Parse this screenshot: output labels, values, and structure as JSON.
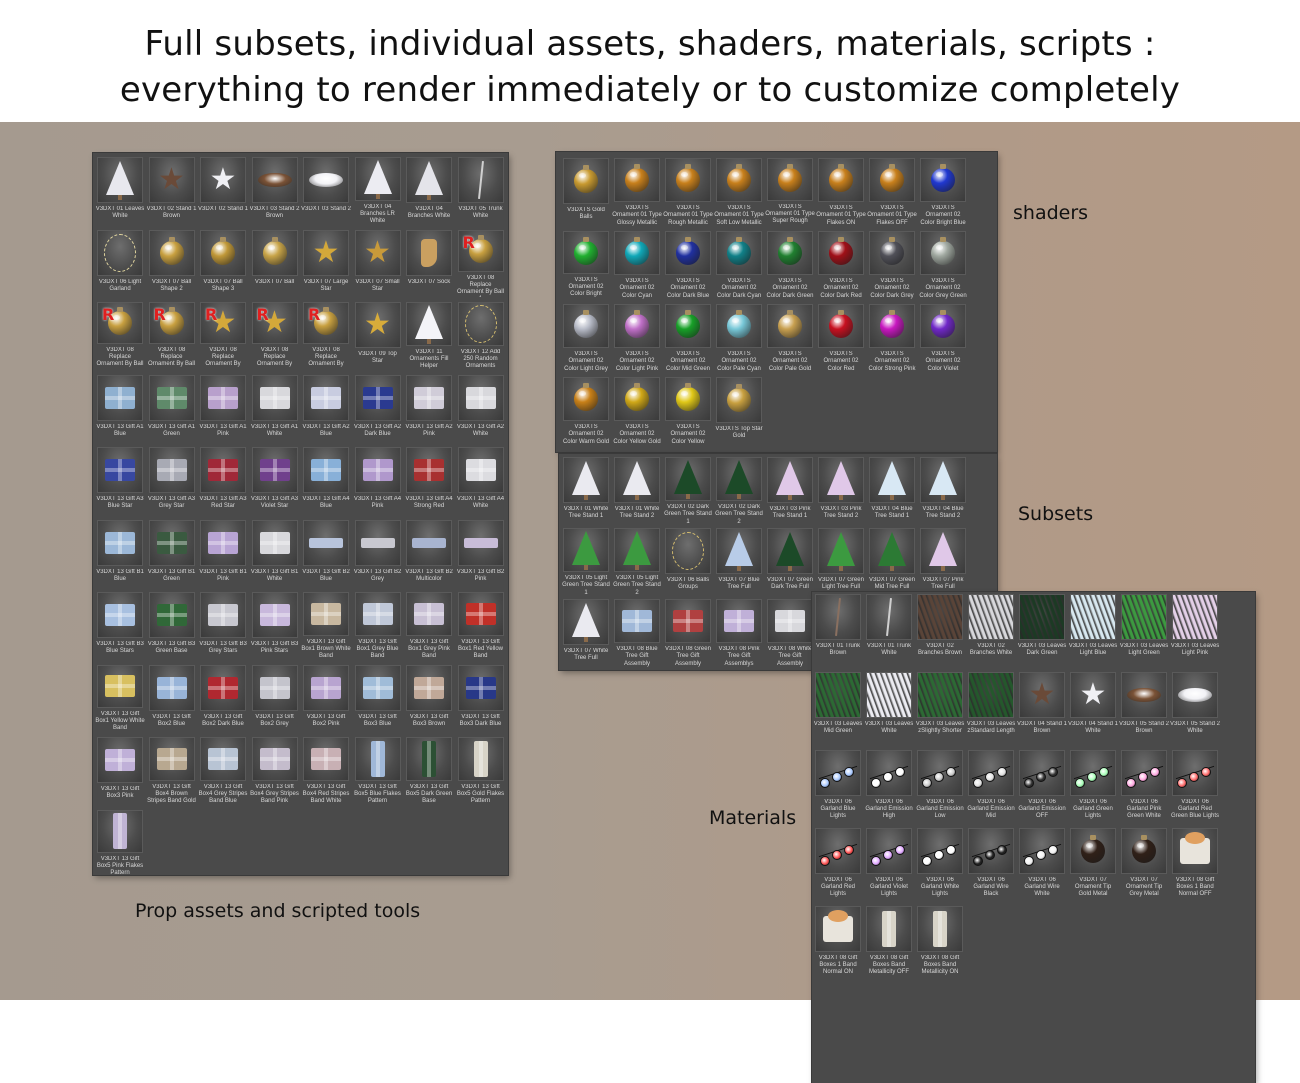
{
  "headline": {
    "line1": "Full subsets, individual assets, shaders, materials, scripts :",
    "line2": "everything to render immediately or to customize completely"
  },
  "labels": {
    "props": "Prop assets and scripted tools",
    "shaders": "shaders",
    "subsets": "Subsets",
    "materials": "Materials"
  },
  "props_panel": [
    {
      "name": "V3DXT 01 Leaves White",
      "icon": "tree-icon",
      "color": "#e8e8ee"
    },
    {
      "name": "V3DXT 02 Stand 1 Brown",
      "icon": "star-icon",
      "color": "#6a4a38"
    },
    {
      "name": "V3DXT 02 Stand 1",
      "icon": "star-icon",
      "color": "#f0f0f4"
    },
    {
      "name": "V3DXT 03 Stand 2 Brown",
      "icon": "disc-icon",
      "color": "#7a5236"
    },
    {
      "name": "V3DXT 03 Stand 2",
      "icon": "disc-icon",
      "color": "#f2f2f6"
    },
    {
      "name": "V3DXT 04 Branches LR White",
      "icon": "tree-icon",
      "color": "#ececf2"
    },
    {
      "name": "V3DXT 04 Branches White",
      "icon": "tree-icon",
      "color": "#e4e4ea"
    },
    {
      "name": "V3DXT 05 Trunk White",
      "icon": "needle-icon",
      "color": "#d0d0d0"
    },
    {
      "name": "V3DXT 06 Light Garland",
      "icon": "string-icon",
      "color": "#e4d8a0"
    },
    {
      "name": "V3DXT 07 Ball Shape 2",
      "icon": "ball-icon",
      "color": "#c8a040"
    },
    {
      "name": "V3DXT 07 Ball Shape 3",
      "icon": "ball-icon",
      "color": "#c09838"
    },
    {
      "name": "V3DXT 07 Ball",
      "icon": "ball-icon",
      "color": "#c8a448"
    },
    {
      "name": "V3DXT 07 Large Star",
      "icon": "star-icon",
      "color": "#d4a83a"
    },
    {
      "name": "V3DXT 07 Small Star",
      "icon": "star-icon",
      "color": "#c89a3a"
    },
    {
      "name": "V3DXT 07 Sock",
      "icon": "sock-icon",
      "color": "#caa060"
    },
    {
      "name": "V3DXT 08 Replace Ornament By Ball 1",
      "icon": "replace-ball-icon",
      "color": "#c8a040"
    },
    {
      "name": "V3DXT 08 Replace Ornament By Ball 2",
      "icon": "replace-ball-icon",
      "color": "#c8a040"
    },
    {
      "name": "V3DXT 08 Replace Ornament By Ball 3",
      "icon": "replace-ball-icon",
      "color": "#c8a040"
    },
    {
      "name": "V3DXT 08 Replace Ornament By Large Star",
      "icon": "replace-star-icon",
      "color": "#d4a83a"
    },
    {
      "name": "V3DXT 08 Replace Ornament By Small Star",
      "icon": "replace-star-icon",
      "color": "#d4a83a"
    },
    {
      "name": "V3DXT 08 Replace Ornament By Sock",
      "icon": "replace-ball-icon",
      "color": "#c8a040"
    },
    {
      "name": "V3DXT 09 Top Star",
      "icon": "star-icon",
      "color": "#d8ac3a"
    },
    {
      "name": "V3DXT 11 Ornaments Fill Helper",
      "icon": "tree-icon",
      "color": "#f4f4f8"
    },
    {
      "name": "V3DXT 12 Add 250 Random Ornaments",
      "icon": "string-icon",
      "color": "#d8c070"
    },
    {
      "name": "V3DXT 13 Gift A1 Blue",
      "icon": "box-icon",
      "color": "#8fb0d0"
    },
    {
      "name": "V3DXT 13 Gift A1 Green",
      "icon": "box-icon",
      "color": "#5f8a6a"
    },
    {
      "name": "V3DXT 13 Gift A1 Pink",
      "icon": "box-icon",
      "color": "#b8a0cc"
    },
    {
      "name": "V3DXT 13 Gift A1 White",
      "icon": "box-icon",
      "color": "#d8d8dc"
    },
    {
      "name": "V3DXT 13 Gift A2 Blue",
      "icon": "box-icon",
      "color": "#c8cce0"
    },
    {
      "name": "V3DXT 13 Gift A2 Dark Blue",
      "icon": "box-icon",
      "color": "#2a3a90"
    },
    {
      "name": "V3DXT 13 Gift A2 Pink",
      "icon": "box-icon",
      "color": "#d0ccd8"
    },
    {
      "name": "V3DXT 13 Gift A2 White",
      "icon": "box-icon",
      "color": "#d8d8dc"
    },
    {
      "name": "V3DXT 13 Gift A3 Blue Star",
      "icon": "box-icon",
      "color": "#3848a0"
    },
    {
      "name": "V3DXT 13 Gift A3 Grey Star",
      "icon": "box-icon",
      "color": "#a8aab4"
    },
    {
      "name": "V3DXT 13 Gift A3 Red Star",
      "icon": "box-icon",
      "color": "#a02838"
    },
    {
      "name": "V3DXT 13 Gift A3 Violet Star",
      "icon": "box-icon",
      "color": "#70408c"
    },
    {
      "name": "V3DXT 13 Gift A4 Blue",
      "icon": "box-icon",
      "color": "#88b0d8"
    },
    {
      "name": "V3DXT 13 Gift A4 Pink",
      "icon": "box-icon",
      "color": "#b098cc"
    },
    {
      "name": "V3DXT 13 Gift A4 Strong Red",
      "icon": "box-icon",
      "color": "#a83030"
    },
    {
      "name": "V3DXT 13 Gift A4 White",
      "icon": "box-icon",
      "color": "#dcdce0"
    },
    {
      "name": "V3DXT 13 Gift B1 Blue",
      "icon": "box-icon",
      "color": "#9cb8d8"
    },
    {
      "name": "V3DXT 13 Gift B1 Green",
      "icon": "box-icon",
      "color": "#3a5a40"
    },
    {
      "name": "V3DXT 13 Gift B1 Pink",
      "icon": "box-icon",
      "color": "#b8a4d4"
    },
    {
      "name": "V3DXT 13 Gift B1 White",
      "icon": "box-icon",
      "color": "#d8d8dc"
    },
    {
      "name": "V3DXT 13 Gift B2 Blue",
      "icon": "slab-icon",
      "color": "#b8c4dc"
    },
    {
      "name": "V3DXT 13 Gift B2 Grey",
      "icon": "slab-icon",
      "color": "#c8c8d0"
    },
    {
      "name": "V3DXT 13 Gift B2 Multicolor",
      "icon": "slab-icon",
      "color": "#a8b4d0"
    },
    {
      "name": "V3DXT 13 Gift B2 Pink",
      "icon": "slab-icon",
      "color": "#c8bcd8"
    },
    {
      "name": "V3DXT 13 Gift B3 Blue Stars",
      "icon": "box-icon",
      "color": "#a8c0e0"
    },
    {
      "name": "V3DXT 13 Gift B3 Green Base",
      "icon": "box-icon",
      "color": "#306838"
    },
    {
      "name": "V3DXT 13 Gift B3 Grey Stars",
      "icon": "box-icon",
      "color": "#c8c8d0"
    },
    {
      "name": "V3DXT 13 Gift B3 Pink Stars",
      "icon": "box-icon",
      "color": "#c8b8dc"
    },
    {
      "name": "V3DXT 13 Gift Box1 Brown White Band",
      "icon": "box-icon",
      "color": "#c8b8a0"
    },
    {
      "name": "V3DXT 13 Gift Box1 Grey Blue Band",
      "icon": "box-icon",
      "color": "#c0c8d8"
    },
    {
      "name": "V3DXT 13 Gift Box1 Grey Pink Band",
      "icon": "box-icon",
      "color": "#c8c0d4"
    },
    {
      "name": "V3DXT 13 Gift Box1 Red Yellow Band",
      "icon": "box-icon",
      "color": "#c03028"
    },
    {
      "name": "V3DXT 13 Gift Box1 Yellow White Band",
      "icon": "box-icon",
      "color": "#d8c060"
    },
    {
      "name": "V3DXT 13 Gift Box2 Blue",
      "icon": "box-icon",
      "color": "#98b4d8"
    },
    {
      "name": "V3DXT 13 Gift Box2 Dark Blue",
      "icon": "box-icon",
      "color": "#b02830"
    },
    {
      "name": "V3DXT 13 Gift Box2 Grey",
      "icon": "box-icon",
      "color": "#c4c4cc"
    },
    {
      "name": "V3DXT 13 Gift Box2 Pink",
      "icon": "box-icon",
      "color": "#b8a4d0"
    },
    {
      "name": "V3DXT 13 Gift Box3 Blue",
      "icon": "box-icon",
      "color": "#a0bcd8"
    },
    {
      "name": "V3DXT 13 Gift Box3 Brown",
      "icon": "box-icon",
      "color": "#c0a898"
    },
    {
      "name": "V3DXT 13 Gift Box3 Dark Blue",
      "icon": "box-icon",
      "color": "#283888"
    },
    {
      "name": "V3DXT 13 Gift Box3 Pink",
      "icon": "box-icon",
      "color": "#c0b0d8"
    },
    {
      "name": "V3DXT 13 Gift Box4 Brown Stripes Band Gold",
      "icon": "box-icon",
      "color": "#b8a890"
    },
    {
      "name": "V3DXT 13 Gift Box4 Grey Stripes Band Blue",
      "icon": "box-icon",
      "color": "#b8c4d4"
    },
    {
      "name": "V3DXT 13 Gift Box4 Grey Stripes Band Pink",
      "icon": "box-icon",
      "color": "#c4bccc"
    },
    {
      "name": "V3DXT 13 Gift Box4 Red Stripes Band White",
      "icon": "box-icon",
      "color": "#c8b0b4"
    },
    {
      "name": "V3DXT 13 Gift Box5 Blue Flakes Pattern",
      "icon": "tall-icon",
      "color": "#a0b8d8"
    },
    {
      "name": "V3DXT 13 Gift Box5 Dark Green Base",
      "icon": "tall-icon",
      "color": "#2c5034"
    },
    {
      "name": "V3DXT 13 Gift Box5 Gold Flakes Pattern",
      "icon": "tall-icon",
      "color": "#d8d4c8"
    },
    {
      "name": "V3DXT 13 Gift Box5 Pink Flakes Pattern",
      "icon": "tall-icon",
      "color": "#c0b4d4"
    }
  ],
  "shaders_panel": [
    {
      "name": "V3DXTS Gold Balls",
      "icon": "ball-icon",
      "color": "#c89a30"
    },
    {
      "name": "V3DXTS Ornament 01 Type Glossy Metallic",
      "icon": "ball-icon",
      "color": "#c8801c"
    },
    {
      "name": "V3DXTS Ornament 01 Type Rough Metallic",
      "icon": "ball-icon",
      "color": "#c8801c"
    },
    {
      "name": "V3DXTS Ornament 01 Type Soft Low Metallic",
      "icon": "ball-icon",
      "color": "#c8801c"
    },
    {
      "name": "V3DXTS Ornament 01 Type Super Rough Metallic",
      "icon": "ball-icon",
      "color": "#c8801c"
    },
    {
      "name": "V3DXTS Ornament 01 Type Flakes ON",
      "icon": "ball-icon",
      "color": "#c8801c"
    },
    {
      "name": "V3DXTS Ornament 01 Type Flakes OFF",
      "icon": "ball-icon",
      "color": "#c8801c"
    },
    {
      "name": "V3DXTS Ornament 02 Color Bright Blue",
      "icon": "ball-icon",
      "color": "#2038d0"
    },
    {
      "name": "V3DXTS Ornament 02 Color Bright Green",
      "icon": "ball-icon",
      "color": "#20b030"
    },
    {
      "name": "V3DXTS Ornament 02 Color Cyan",
      "icon": "ball-icon",
      "color": "#10a8b8"
    },
    {
      "name": "V3DXTS Ornament 02 Color Dark Blue",
      "icon": "ball-icon",
      "color": "#2030a0"
    },
    {
      "name": "V3DXTS Ornament 02 Color Dark Cyan",
      "icon": "ball-icon",
      "color": "#108088"
    },
    {
      "name": "V3DXTS Ornament 02 Color Dark Green",
      "icon": "ball-icon",
      "color": "#208030"
    },
    {
      "name": "V3DXTS Ornament 02 Color Dark Red",
      "icon": "ball-icon",
      "color": "#a01018"
    },
    {
      "name": "V3DXTS Ornament 02 Color Dark Grey",
      "icon": "ball-icon",
      "color": "#505058"
    },
    {
      "name": "V3DXTS Ornament 02 Color Grey Green",
      "icon": "ball-icon",
      "color": "#a0a8a0"
    },
    {
      "name": "V3DXTS Ornament 02 Color Light Grey",
      "icon": "ball-icon",
      "color": "#b8bcc8"
    },
    {
      "name": "V3DXTS Ornament 02 Color Light Pink",
      "icon": "ball-icon",
      "color": "#c070c8"
    },
    {
      "name": "V3DXTS Ornament 02 Color Mid Green",
      "icon": "ball-icon",
      "color": "#18a028"
    },
    {
      "name": "V3DXTS Ornament 02 Color Pale Cyan",
      "icon": "ball-icon",
      "color": "#78c8d8"
    },
    {
      "name": "V3DXTS Ornament 02 Color Pale Gold",
      "icon": "ball-icon",
      "color": "#c8a050"
    },
    {
      "name": "V3DXTS Ornament 02 Color Red",
      "icon": "ball-icon",
      "color": "#c81020"
    },
    {
      "name": "V3DXTS Ornament 02 Color Strong Pink",
      "icon": "ball-icon",
      "color": "#c818c0"
    },
    {
      "name": "V3DXTS Ornament 02 Color Violet",
      "icon": "ball-icon",
      "color": "#7028c8"
    },
    {
      "name": "V3DXTS Ornament 02 Color Warm Gold",
      "icon": "ball-icon",
      "color": "#c88018"
    },
    {
      "name": "V3DXTS Ornament 02 Color Yellow Gold",
      "icon": "ball-icon",
      "color": "#d0a818"
    },
    {
      "name": "V3DXTS Ornament 02 Color Yellow",
      "icon": "ball-icon",
      "color": "#e0c818"
    },
    {
      "name": "V3DXTS Top Star Gold",
      "icon": "ball-icon",
      "color": "#c8a040"
    }
  ],
  "subsets_panel": [
    {
      "name": "V3DXT 01 White Tree Stand 1",
      "icon": "tree-icon",
      "color": "#eaeaf0"
    },
    {
      "name": "V3DXT 01 White Tree Stand 2",
      "icon": "tree-icon",
      "color": "#eaeaf0"
    },
    {
      "name": "V3DXT 02 Dark Green Tree Stand 1",
      "icon": "tree-icon",
      "color": "#1c4a28"
    },
    {
      "name": "V3DXT 02 Dark Green Tree Stand 2",
      "icon": "tree-icon",
      "color": "#1c4a28"
    },
    {
      "name": "V3DXT 03 Pink Tree Stand 1",
      "icon": "tree-icon",
      "color": "#e0c8e8"
    },
    {
      "name": "V3DXT 03 Pink Tree Stand 2",
      "icon": "tree-icon",
      "color": "#e0c8e8"
    },
    {
      "name": "V3DXT 04 Blue Tree Stand 1",
      "icon": "tree-icon",
      "color": "#d8e8f4"
    },
    {
      "name": "V3DXT 04 Blue Tree Stand 2",
      "icon": "tree-icon",
      "color": "#d8e8f4"
    },
    {
      "name": "V3DXT 05 Light Green Tree Stand 1",
      "icon": "tree-icon",
      "color": "#3c9a40"
    },
    {
      "name": "V3DXT 05 Light Green Tree Stand 2",
      "icon": "tree-icon",
      "color": "#3c9a40"
    },
    {
      "name": "V3DXT 06 Balls Groups",
      "icon": "string-icon",
      "color": "#d8c070"
    },
    {
      "name": "V3DXT 07 Blue Tree Full",
      "icon": "tree-icon",
      "color": "#b8cce8"
    },
    {
      "name": "V3DXT 07 Green Dark Tree Full",
      "icon": "tree-icon",
      "color": "#1c4a28"
    },
    {
      "name": "V3DXT 07 Green Light Tree Full",
      "icon": "tree-icon",
      "color": "#3c9a40"
    },
    {
      "name": "V3DXT 07 Green Mid Tree Full",
      "icon": "tree-icon",
      "color": "#2c7a34"
    },
    {
      "name": "V3DXT 07 Pink Tree Full",
      "icon": "tree-icon",
      "color": "#e0c8e8"
    },
    {
      "name": "V3DXT 07 White Tree Full",
      "icon": "tree-icon",
      "color": "#eaeaf0"
    },
    {
      "name": "V3DXT 08 Blue Tree Gift Assembly",
      "icon": "box-icon",
      "color": "#a0b8d8"
    },
    {
      "name": "V3DXT 08 Green Tree Gift Assembly",
      "icon": "box-icon",
      "color": "#b04040"
    },
    {
      "name": "V3DXT 08 Pink Tree Gift Assemblys",
      "icon": "box-icon",
      "color": "#c0b0d8"
    },
    {
      "name": "V3DXT 08 White Tree Gift Assembly",
      "icon": "box-icon",
      "color": "#d8d8dc"
    }
  ],
  "materials_panel": [
    {
      "name": "V3DXT 01 Trunk Brown",
      "icon": "needle-icon",
      "color": "#8a7060"
    },
    {
      "name": "V3DXT 01 Trunk White",
      "icon": "needle-icon",
      "color": "#d0d0d0"
    },
    {
      "name": "V3DXT 02 Branches Brown",
      "icon": "needles-icon",
      "color": "#5a4438"
    },
    {
      "name": "V3DXT 02 Branches White",
      "icon": "needles-icon",
      "color": "#d8d8dc"
    },
    {
      "name": "V3DXT 03 Leaves Dark Green",
      "icon": "needles-icon",
      "color": "#1c3a24"
    },
    {
      "name": "V3DXT 03 Leaves Light Blue",
      "icon": "needles-icon",
      "color": "#d8e8f0"
    },
    {
      "name": "V3DXT 03 Leaves Light Green",
      "icon": "needles-icon",
      "color": "#3c9a40"
    },
    {
      "name": "V3DXT 03 Leaves Light Pink",
      "icon": "needles-icon",
      "color": "#e4d0e8"
    },
    {
      "name": "V3DXT 03 Leaves Mid Green",
      "icon": "needles-icon",
      "color": "#2c6a34"
    },
    {
      "name": "V3DXT 03 Leaves White",
      "icon": "needles-icon",
      "color": "#ececf2"
    },
    {
      "name": "V3DXT 03 Leaves zSlightly Shorter",
      "icon": "needles-icon",
      "color": "#2c6a34"
    },
    {
      "name": "V3DXT 03 Leaves zStandard Length",
      "icon": "needles-icon",
      "color": "#24582c"
    },
    {
      "name": "V3DXT 04 Stand 1 Brown",
      "icon": "star-icon",
      "color": "#6a4a38"
    },
    {
      "name": "V3DXT 04 Stand 1 White",
      "icon": "star-icon",
      "color": "#f0f0f4"
    },
    {
      "name": "V3DXT 05 Stand 2 Brown",
      "icon": "disc-icon",
      "color": "#7a5236"
    },
    {
      "name": "V3DXT 05 Stand 2 White",
      "icon": "disc-icon",
      "color": "#f2f2f6"
    },
    {
      "name": "V3DXT 06 Garland Blue Lights",
      "icon": "lights-icon",
      "color": "#a8c8ff"
    },
    {
      "name": "V3DXT 06 Garland Emission High",
      "icon": "lights-icon",
      "color": "#ffffff"
    },
    {
      "name": "V3DXT 06 Garland Emission Low",
      "icon": "lights-icon",
      "color": "#c8c8c8"
    },
    {
      "name": "V3DXT 06 Garland Emission Mid",
      "icon": "lights-icon",
      "color": "#e0e0e0"
    },
    {
      "name": "V3DXT 06 Garland Emission OFF",
      "icon": "lights-icon",
      "color": "#303030"
    },
    {
      "name": "V3DXT 06 Garland Green Lights",
      "icon": "lights-icon",
      "color": "#a8ffb8"
    },
    {
      "name": "V3DXT 06 Garland Pink Green White Lights",
      "icon": "lights-icon",
      "color": "#ffa8e0"
    },
    {
      "name": "V3DXT 06 Garland Red Green Blue Lights",
      "icon": "lights-icon",
      "color": "#ff6868"
    },
    {
      "name": "V3DXT 06 Garland Red Lights",
      "icon": "lights-icon",
      "color": "#ff5050"
    },
    {
      "name": "V3DXT 06 Garland Violet Lights",
      "icon": "lights-icon",
      "color": "#e0a8ff"
    },
    {
      "name": "V3DXT 06 Garland White Lights",
      "icon": "lights-icon",
      "color": "#ffffff"
    },
    {
      "name": "V3DXT 06 Garland Wire Black",
      "icon": "lights-icon",
      "color": "#202020"
    },
    {
      "name": "V3DXT 06 Garland Wire White",
      "icon": "lights-icon",
      "color": "#f0f0f0"
    },
    {
      "name": "V3DXT 07 Ornament Tip Gold Metal",
      "icon": "ball-icon",
      "color": "#302018"
    },
    {
      "name": "V3DXT 07 Ornament Tip Grey Metal",
      "icon": "ball-icon",
      "color": "#302018"
    },
    {
      "name": "V3DXT 08 Gift Boxes 1 Band Normal OFF",
      "icon": "bow-icon",
      "color": "#b87840"
    },
    {
      "name": "V3DXT 08 Gift Boxes 1 Band Normal ON",
      "icon": "bow-icon",
      "color": "#c08850"
    },
    {
      "name": "V3DXT 08 Gift Boxes Band Metallicity OFF",
      "icon": "tall-icon",
      "color": "#d8d4c8"
    },
    {
      "name": "V3DXT 08 Gift Boxes Band Metallicity ON",
      "icon": "tall-icon",
      "color": "#d8d4c8"
    }
  ]
}
